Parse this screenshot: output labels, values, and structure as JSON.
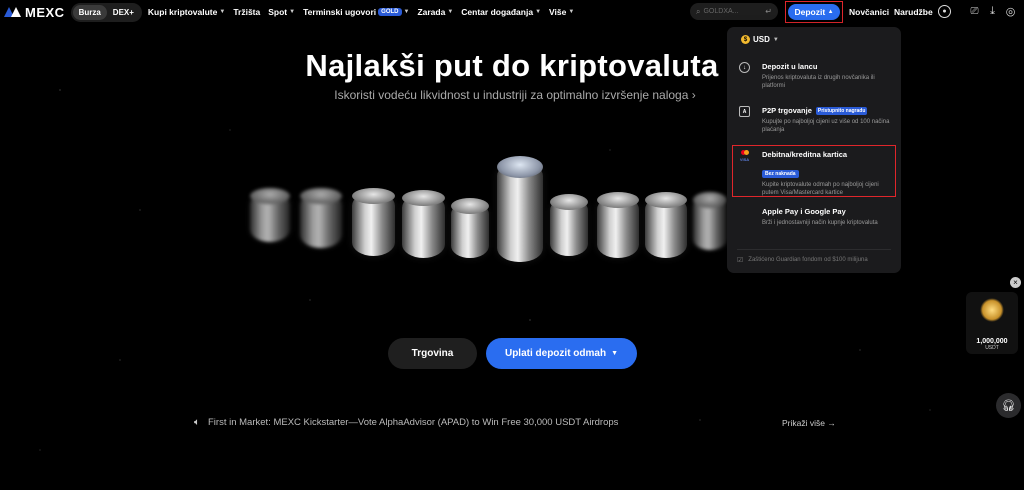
{
  "nav": {
    "logo_text": "MEXC",
    "seg": [
      "Burza",
      "DEX+"
    ],
    "items": [
      {
        "label": "Kupi kriptovalute",
        "caret": true
      },
      {
        "label": "Tržišta",
        "caret": false
      },
      {
        "label": "Spot",
        "caret": true
      },
      {
        "label": "Terminski ugovori",
        "caret": true,
        "badge": "GOLD"
      },
      {
        "label": "Zarada",
        "caret": true
      },
      {
        "label": "Centar događanja",
        "caret": true
      },
      {
        "label": "Više",
        "caret": true
      }
    ],
    "search_placeholder": "GOLDXA...",
    "deposit_label": "Depozit",
    "wallets": "Novčanici",
    "orders": "Narudžbe"
  },
  "hero": {
    "title": "Najlakši put do kriptovaluta",
    "subtitle": "Iskoristi vodeću likvidnost u industriji za optimalno izvršenje naloga",
    "trade_btn": "Trgovina",
    "deposit_btn": "Uplati depozit odmah"
  },
  "ticker": {
    "text": "First in Market: MEXC Kickstarter—Vote AlphaAdvisor (APAD) to Win Free 30,000 USDT Airdrops",
    "more": "Prikaži više"
  },
  "dropdown": {
    "currency": "USD",
    "items": [
      {
        "title": "Depozit u lancu",
        "desc": "Prijenos kriptovaluta iz drugih novčanika ili platformi"
      },
      {
        "title": "P2P trgovanje",
        "tag": "Pristupnito nagradu",
        "desc": "Kupujte po najboljoj cijeni uz više od 100 načina plaćanja"
      },
      {
        "title": "Debitna/kreditna kartica",
        "tag": "Bez naknada",
        "desc": "Kupite kriptovalute odmah po najboljoj cijeni putem Visa/Mastercard kartice"
      },
      {
        "title": "Apple Pay i Google Pay",
        "desc": "Brži i jednostavniji način kupnje kriptovaluta"
      }
    ],
    "guard": "Zaštićeno Guardian fondom od $100 milijuna"
  },
  "promo": {
    "amount": "1,000,000",
    "unit": "USDT"
  },
  "colors": {
    "accent": "#2a6df0",
    "highlight": "#e0262b",
    "bg": "#000000"
  }
}
